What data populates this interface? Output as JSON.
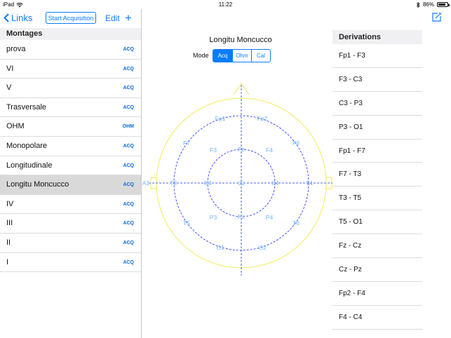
{
  "status": {
    "device": "iPad",
    "time": "11:22",
    "battery": "86%",
    "battery_level": 0.86
  },
  "nav": {
    "back_label": "Links",
    "start_label": "Start Acquisition",
    "edit_label": "Edit",
    "add_label": "+"
  },
  "montages": {
    "header": "Montages",
    "items": [
      {
        "name": "prova",
        "tag": "ACQ"
      },
      {
        "name": "VI",
        "tag": "ACQ"
      },
      {
        "name": "V",
        "tag": "ACQ"
      },
      {
        "name": "Trasversale",
        "tag": "ACQ"
      },
      {
        "name": "OHM",
        "tag": "OHM"
      },
      {
        "name": "Monopolare",
        "tag": "ACQ"
      },
      {
        "name": "Longitudinale",
        "tag": "ACQ"
      },
      {
        "name": "Longitu Moncucco",
        "tag": "ACQ",
        "selected": true
      },
      {
        "name": "IV",
        "tag": "ACQ"
      },
      {
        "name": "III",
        "tag": "ACQ"
      },
      {
        "name": "II",
        "tag": "ACQ"
      },
      {
        "name": "I",
        "tag": "ACQ"
      }
    ]
  },
  "center": {
    "title": "Longitu Moncucco",
    "mode_label": "Mode",
    "modes": [
      "Acq",
      "Ohm",
      "Cal"
    ],
    "active_mode": "Acq",
    "electrodes": [
      "Fp1",
      "Fp2",
      "F7",
      "F3",
      "Fz",
      "F4",
      "F8",
      "A1",
      "T3",
      "C3",
      "Cz",
      "C4",
      "T4",
      "A2",
      "T5",
      "P3",
      "Pz",
      "P4",
      "T6",
      "O1",
      "O2"
    ]
  },
  "derivations": {
    "header": "Derivations",
    "items": [
      "Fp1 - F3",
      "F3 - C3",
      "C3 - P3",
      "P3 - O1",
      "Fp1 - F7",
      "F7 - T3",
      "T3 - T5",
      "T5 - O1",
      "Fz - Cz",
      "Cz - Pz",
      "Fp2 - F4",
      "F4 - C4"
    ]
  },
  "colors": {
    "accent": "#0a7cff",
    "head_outline": "#f2ea5a",
    "electrode": "#6fb4ff",
    "grid": "#1a2cff"
  }
}
